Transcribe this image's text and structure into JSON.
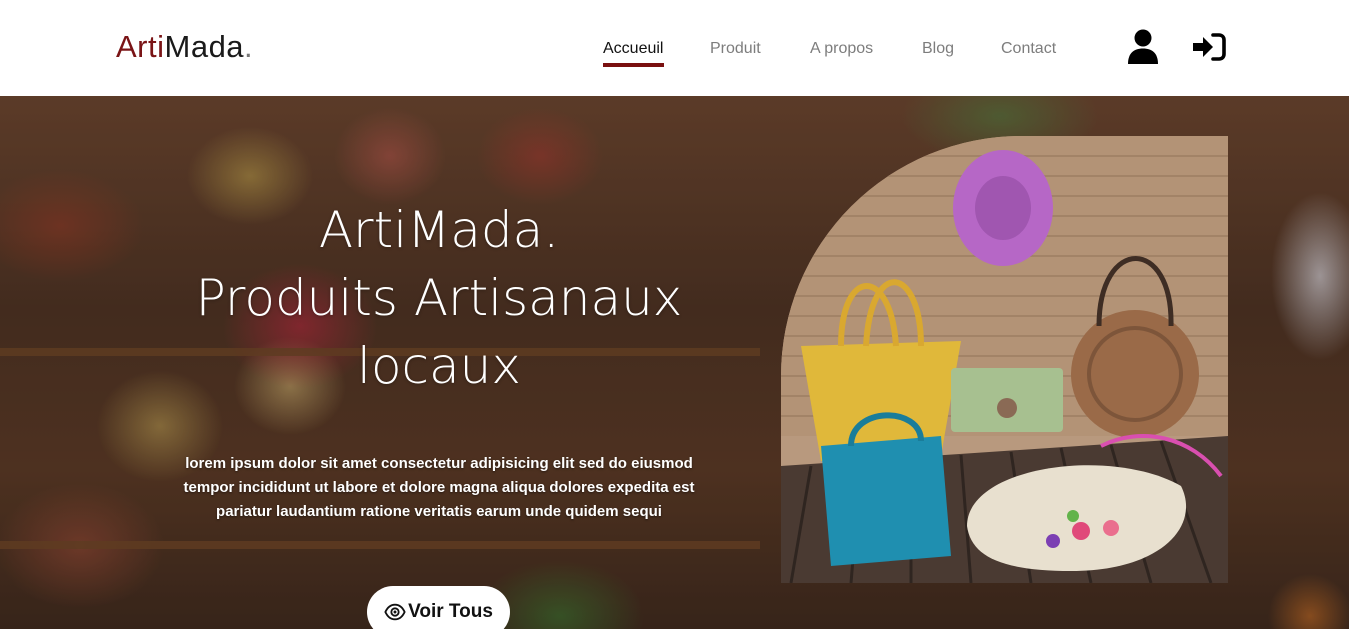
{
  "brand": {
    "part1": "Arti",
    "part2": "Mada",
    "dot": ".",
    "accent_color": "#7a1416"
  },
  "nav": {
    "items": [
      {
        "label": "Accueuil",
        "active": true
      },
      {
        "label": "Produit",
        "active": false
      },
      {
        "label": "A propos",
        "active": false
      },
      {
        "label": "Blog",
        "active": false
      },
      {
        "label": "Contact",
        "active": false
      }
    ],
    "active_underline_color": "#7a1010"
  },
  "header_icons": {
    "account": "user-icon",
    "login": "sign-in-icon"
  },
  "hero": {
    "title_lines": [
      "ArtiMada.",
      "Produits Artisanaux",
      "locaux"
    ],
    "description": "lorem ipsum dolor sit amet consectetur adipisicing elit sed do eiusmod tempor incididunt ut labore et dolore magna aliqua dolores expedita est pariatur laudantium ratione veritatis earum unde quidem sequi",
    "button_label": "Voir Tous",
    "button_icon": "eye-icon"
  }
}
